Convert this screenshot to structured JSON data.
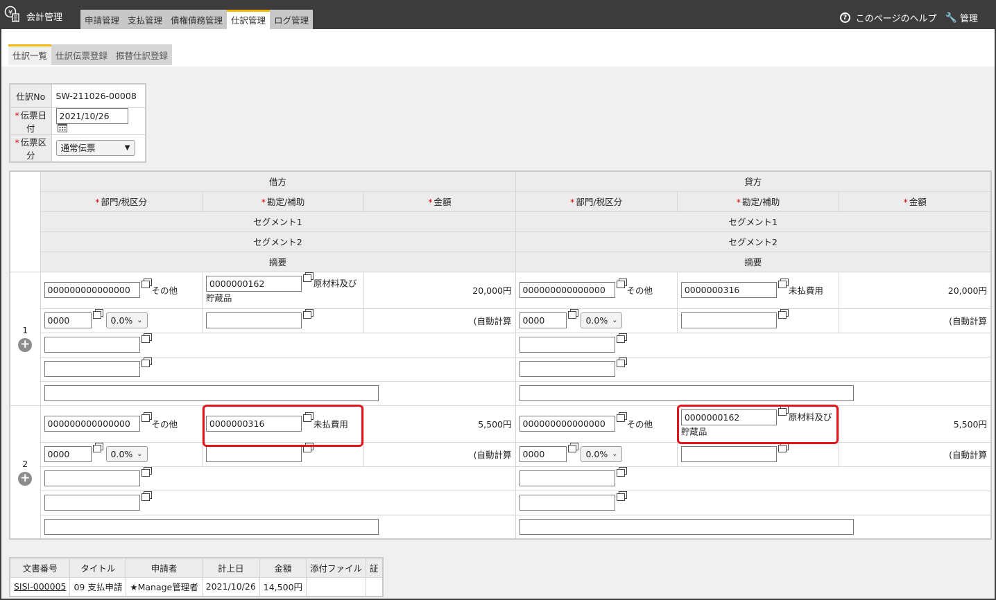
{
  "app": {
    "title": "会計管理"
  },
  "main_tabs": [
    {
      "label": "申請管理",
      "active": false
    },
    {
      "label": "支払管理",
      "active": false
    },
    {
      "label": "債権債務管理",
      "active": false
    },
    {
      "label": "仕訳管理",
      "active": true
    },
    {
      "label": "ログ管理",
      "active": false
    }
  ],
  "header_links": {
    "help": "このページのヘルプ",
    "admin": "管理"
  },
  "sub_tabs": [
    {
      "label": "仕訳一覧",
      "active": true
    },
    {
      "label": "仕訳伝票登録",
      "active": false
    },
    {
      "label": "振替仕訳登録",
      "active": false
    }
  ],
  "voucher": {
    "no_label": "仕訳No",
    "no_value": "SW-211026-00008",
    "date_label": "伝票日付",
    "date_value": "2021/10/26",
    "type_label": "伝票区分",
    "type_value": "通常伝票"
  },
  "grid": {
    "debit_header": "借方",
    "credit_header": "貸方",
    "col_dept": "部門/税区分",
    "col_account": "勘定/補助",
    "col_amount": "金額",
    "segment1": "セグメント1",
    "segment2": "セグメント2",
    "memo": "摘要",
    "rows": [
      {
        "no": "1",
        "debit": {
          "dept_code": "000000000000000",
          "dept_name": "その他",
          "tax_code": "0000",
          "tax_rate": "0.0%",
          "account_code": "0000000162",
          "account_name_1": "原材料及び",
          "account_name_2": "貯蔵品",
          "sub_code": "",
          "amount": "20,000円",
          "tax_note": "(自動計算"
        },
        "credit": {
          "dept_code": "000000000000000",
          "dept_name": "その他",
          "tax_code": "0000",
          "tax_rate": "0.0%",
          "account_code": "0000000316",
          "account_name_1": "未払費用",
          "account_name_2": "",
          "sub_code": "",
          "amount": "20,000円",
          "tax_note": "(自動計算"
        }
      },
      {
        "no": "2",
        "debit": {
          "dept_code": "000000000000000",
          "dept_name": "その他",
          "tax_code": "0000",
          "tax_rate": "0.0%",
          "account_code": "0000000316",
          "account_name_1": "未払費用",
          "account_name_2": "",
          "sub_code": "",
          "amount": "5,500円",
          "tax_note": "(自動計算"
        },
        "credit": {
          "dept_code": "000000000000000",
          "dept_name": "その他",
          "tax_code": "0000",
          "tax_rate": "0.0%",
          "account_code": "0000000162",
          "account_name_1": "原材料及び",
          "account_name_2": "貯蔵品",
          "sub_code": "",
          "amount": "5,500円",
          "tax_note": "(自動計算"
        }
      }
    ]
  },
  "documents": {
    "headers": [
      "文書番号",
      "タイトル",
      "申請者",
      "計上日",
      "金額",
      "添付ファイル",
      "証"
    ],
    "rows": [
      [
        "SISI-000005",
        "09 支払申請",
        "★Manage管理者",
        "2021/10/26",
        "14,500円",
        "",
        ""
      ]
    ]
  },
  "colors": {
    "accent": "#f5b800",
    "highlight": "#e5141b",
    "topbar": "#3c3c3c"
  }
}
